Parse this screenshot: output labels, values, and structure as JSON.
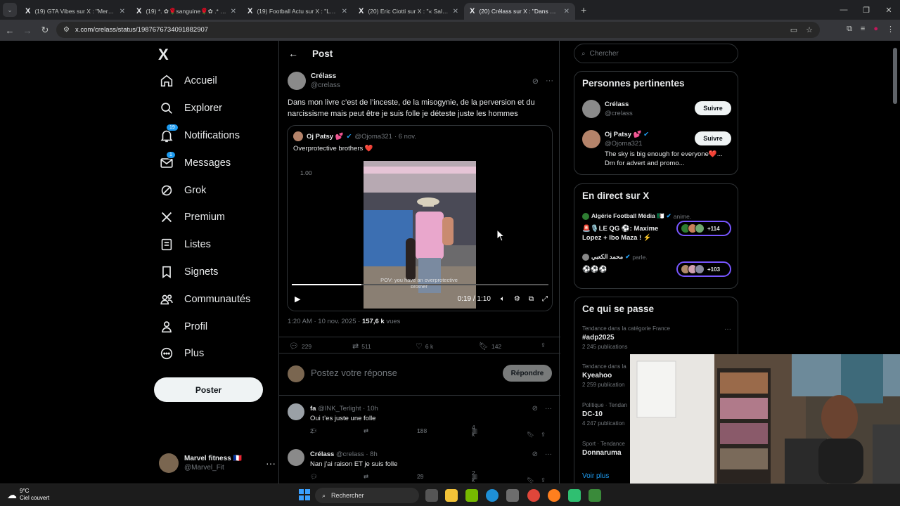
{
  "browser": {
    "tabs": [
      {
        "title": "(19) GTA Vibes sur X : \"Merci. G",
        "active": false
      },
      {
        "title": "(19) *. ✿🌹sanguine🌹✿ .* (@",
        "active": false
      },
      {
        "title": "(19) Football Actu sur X : \"Luca",
        "active": false
      },
      {
        "title": "(20) Eric Ciotti sur X : \"« Sale gu",
        "active": false
      },
      {
        "title": "(20) Crélass sur X : \"Dans mon l",
        "active": true
      }
    ],
    "url": "x.com/crelass/status/1987676734091882907"
  },
  "sidebar": {
    "logo": "X",
    "items": [
      {
        "label": "Accueil",
        "icon": "home-icon"
      },
      {
        "label": "Explorer",
        "icon": "search-icon"
      },
      {
        "label": "Notifications",
        "icon": "bell-icon",
        "badge": "19"
      },
      {
        "label": "Messages",
        "icon": "mail-icon",
        "badge": "1"
      },
      {
        "label": "Grok",
        "icon": "grok-icon"
      },
      {
        "label": "Premium",
        "icon": "x-icon"
      },
      {
        "label": "Listes",
        "icon": "list-icon"
      },
      {
        "label": "Signets",
        "icon": "bookmark-icon"
      },
      {
        "label": "Communautés",
        "icon": "community-icon"
      },
      {
        "label": "Profil",
        "icon": "profile-icon"
      },
      {
        "label": "Plus",
        "icon": "more-icon"
      }
    ],
    "post_button": "Poster",
    "account": {
      "name": "Marvel fitness 🇫🇷",
      "handle": "@Marvel_Fit"
    }
  },
  "main": {
    "title": "Post",
    "tweet": {
      "name": "Crélass",
      "handle": "@crelass",
      "text": "Dans mon livre c’est de l’inceste, de la misogynie, de la perversion et du narcissisme mais peut être je suis folle je déteste juste les hommes",
      "quote": {
        "name": "Oj Patsy 💕",
        "handle": "@Ojoma321",
        "date": "· 6 nov.",
        "text": "Overprotective brothers ❤️",
        "video": {
          "speed": "1.00",
          "time": "0:19 / 1:10",
          "progress": 0.27,
          "caption": "POV: you have an overprotective brother"
        }
      },
      "time": "1:20 AM · 10 nov. 2025 · ",
      "views_count": "157,6 k",
      "views_label": " vues",
      "stats": {
        "replies": "229",
        "retweets": "511",
        "likes": "6 k",
        "bookmarks": "142"
      }
    },
    "reply_placeholder": "Postez votre réponse",
    "reply_button": "Répondre",
    "replies": [
      {
        "name": "fa",
        "handle": "@INK_Terlight",
        "time": "· 10h",
        "text": "Oui t’es juste une folle",
        "replies": "2",
        "retweets": "",
        "likes": "188",
        "views": "4 k"
      },
      {
        "name": "Crélass",
        "handle": "@crelass",
        "time": "· 8h",
        "text": "Nan j’ai raison ET je suis folle",
        "replies": "",
        "retweets": "",
        "likes": "29",
        "views": "2 k"
      }
    ]
  },
  "right": {
    "search_placeholder": "Chercher",
    "relevant_title": "Personnes pertinentes",
    "relevant": [
      {
        "name": "Crélass",
        "handle": "@crelass",
        "bio": "",
        "follow": "Suivre"
      },
      {
        "name": "Oj Patsy 💕",
        "handle": "@Ojoma321",
        "bio": "The sky is big enough for everyone❤️... Dm for advert and promo...",
        "follow": "Suivre"
      }
    ],
    "live_title": "En direct sur X",
    "live": [
      {
        "host": "Algérie Football Média 🇩🇿",
        "status": "anime.",
        "title": "🚨🎙️LE QG ⚽: Maxime Lopez + Ibo Maza ! ⚡",
        "count": "+114"
      },
      {
        "host": "محمد الكعبي",
        "status": "parle.",
        "title": "⚽⚽⚽",
        "count": "+103"
      }
    ],
    "trends_title": "Ce qui se passe",
    "trends": [
      {
        "category": "Tendance dans la catégorie France",
        "topic": "#adp2025",
        "count": "2 245 publications"
      },
      {
        "category": "Tendance dans la",
        "topic": "Kyeahoo",
        "count": "2 259 publication"
      },
      {
        "category": "Politique · Tendan",
        "topic": "DC-10",
        "count": "4 247 publication"
      },
      {
        "category": "Sport · Tendance",
        "topic": "Donnaruma",
        "count": ""
      }
    ],
    "see_more": "Voir plus"
  },
  "taskbar": {
    "temp": "9°C",
    "weather": "Ciel couvert",
    "search": "Rechercher"
  }
}
